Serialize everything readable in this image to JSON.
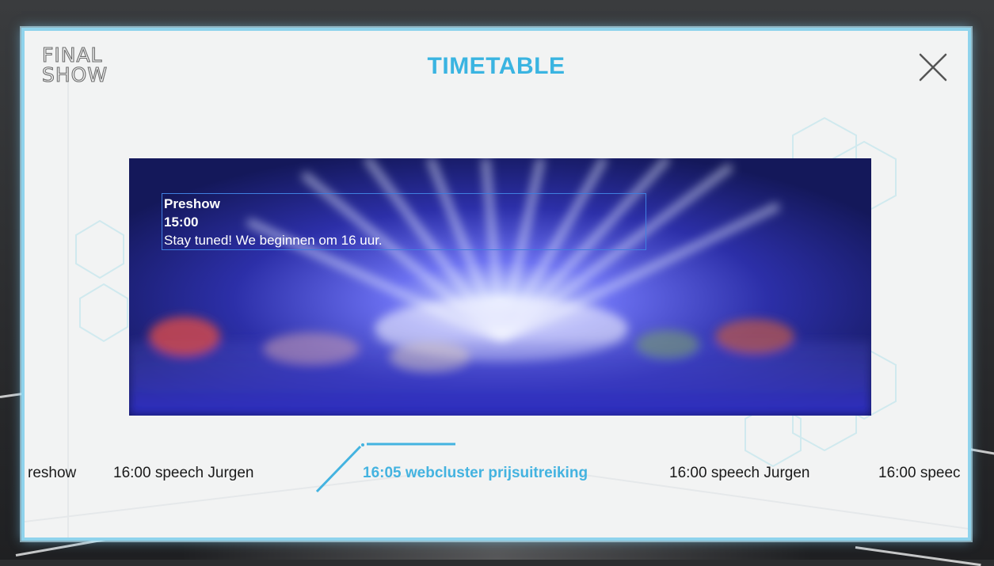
{
  "logo": {
    "line1": "FINAL",
    "line2": "SHOW"
  },
  "header": {
    "title": "TIMETABLE"
  },
  "close": {
    "icon": "close-icon"
  },
  "current_event": {
    "name": "Preshow",
    "time": "15:00",
    "description": "Stay tuned! We beginnen om 16 uur."
  },
  "timeline": {
    "items": [
      {
        "label": "reshow"
      },
      {
        "label": "16:00 speech Jurgen"
      },
      {
        "label": "16:05 webcluster prijsuitreiking"
      },
      {
        "label": "16:00 speech Jurgen"
      },
      {
        "label": "16:00 speec"
      }
    ]
  },
  "colors": {
    "accent": "#3ab4e1",
    "modal_bg": "#f2f3f3",
    "modal_border": "#8fd3ec",
    "info_border": "#3f7fe0"
  }
}
